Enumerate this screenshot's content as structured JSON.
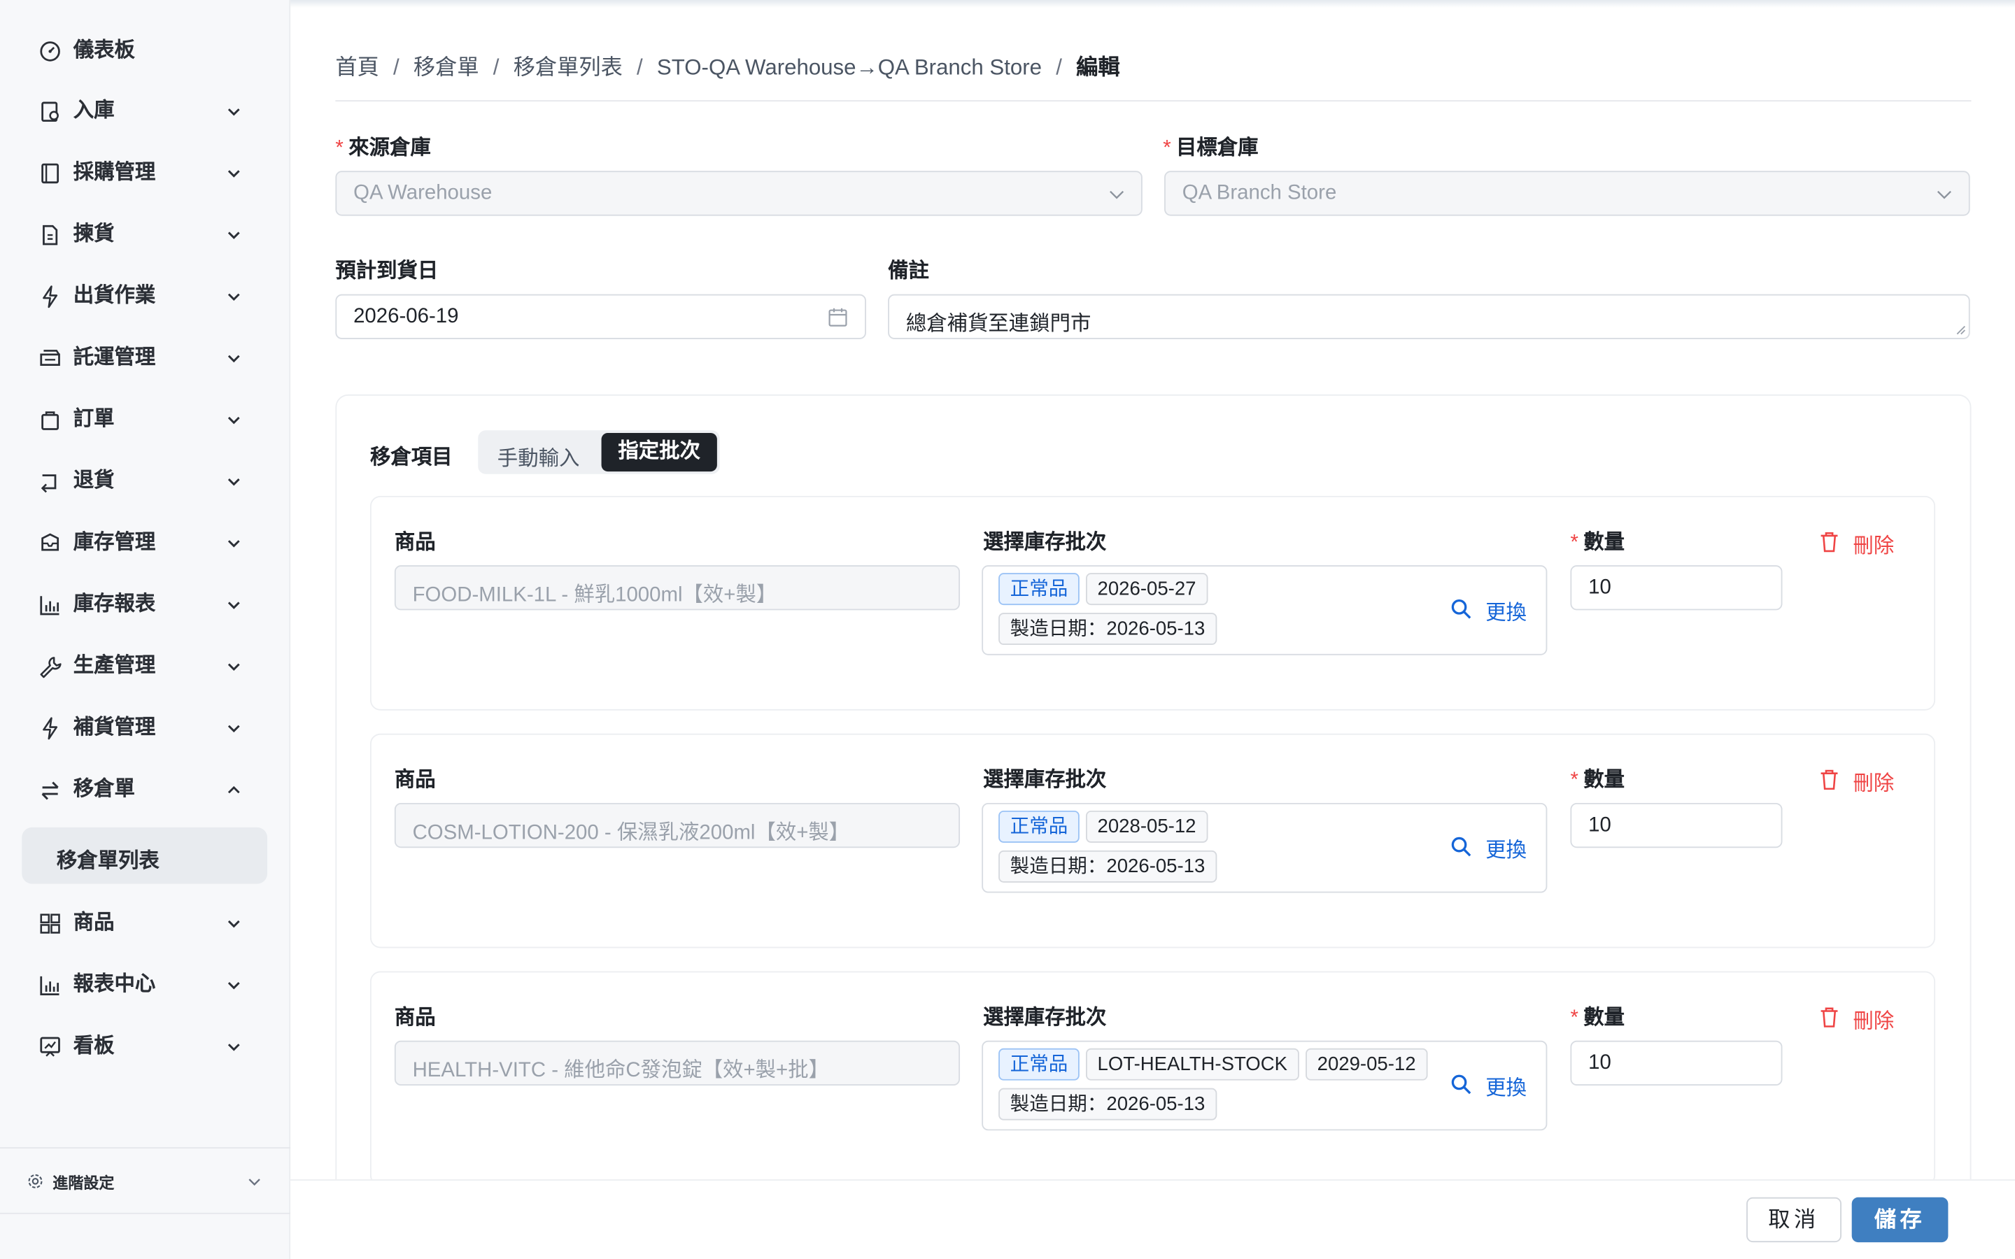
{
  "sidebar": {
    "items": [
      {
        "label": "儀表板",
        "icon": "dashboard-icon"
      },
      {
        "label": "入庫",
        "icon": "inbound-icon"
      },
      {
        "label": "採購管理",
        "icon": "purchase-icon"
      },
      {
        "label": "揀貨",
        "icon": "picking-icon"
      },
      {
        "label": "出貨作業",
        "icon": "bolt-icon"
      },
      {
        "label": "託運管理",
        "icon": "truck-icon"
      },
      {
        "label": "訂單",
        "icon": "bag-icon"
      },
      {
        "label": "退貨",
        "icon": "return-icon"
      },
      {
        "label": "庫存管理",
        "icon": "inventory-icon"
      },
      {
        "label": "庫存報表",
        "icon": "bar-chart-icon"
      },
      {
        "label": "生產管理",
        "icon": "wrench-icon"
      },
      {
        "label": "補貨管理",
        "icon": "bolt-icon"
      },
      {
        "label": "移倉單",
        "icon": "transfer-icon"
      },
      {
        "label": "商品",
        "icon": "grid-icon"
      },
      {
        "label": "報表中心",
        "icon": "bar-chart-icon"
      },
      {
        "label": "看板",
        "icon": "board-icon"
      }
    ],
    "active_sub": "移倉單列表",
    "advanced": "進階設定"
  },
  "breadcrumb": [
    "首頁",
    "移倉單",
    "移倉單列表",
    "STO-QA Warehouse→QA Branch Store",
    "編輯"
  ],
  "form": {
    "source_label": "來源倉庫",
    "source_value": "QA Warehouse",
    "target_label": "目標倉庫",
    "target_value": "QA Branch Store",
    "date_label": "預計到貨日",
    "date_value": "2026-06-19",
    "note_label": "備註",
    "note_value": "總倉補貨至連鎖門市"
  },
  "items_section": {
    "title": "移倉項目",
    "mode_manual": "手動輸入",
    "mode_batch": "指定批次",
    "selected_mode": "指定批次",
    "product_label": "商品",
    "lot_label": "選擇庫存批次",
    "qty_label": "數量",
    "change_label": "更換",
    "delete_label": "刪除",
    "items": [
      {
        "product": "FOOD-MILK-1L - 鮮乳1000ml【效+製】",
        "status": "正常品",
        "lot": "",
        "expiry": "2026-05-27",
        "mfg": "製造日期：2026-05-13",
        "qty": "10"
      },
      {
        "product": "COSM-LOTION-200 - 保濕乳液200ml【效+製】",
        "status": "正常品",
        "lot": "",
        "expiry": "2028-05-12",
        "mfg": "製造日期：2026-05-13",
        "qty": "10"
      },
      {
        "product": "HEALTH-VITC - 維他命C發泡錠【效+製+批】",
        "status": "正常品",
        "lot": "LOT-HEALTH-STOCK",
        "expiry": "2029-05-12",
        "mfg": "製造日期：2026-05-13",
        "qty": "10"
      }
    ]
  },
  "footer": {
    "cancel": "取消",
    "save": "儲存"
  },
  "colors": {
    "primary": "#3f7fc1",
    "danger": "#ef4444",
    "tag_blue": "#1565d8"
  }
}
